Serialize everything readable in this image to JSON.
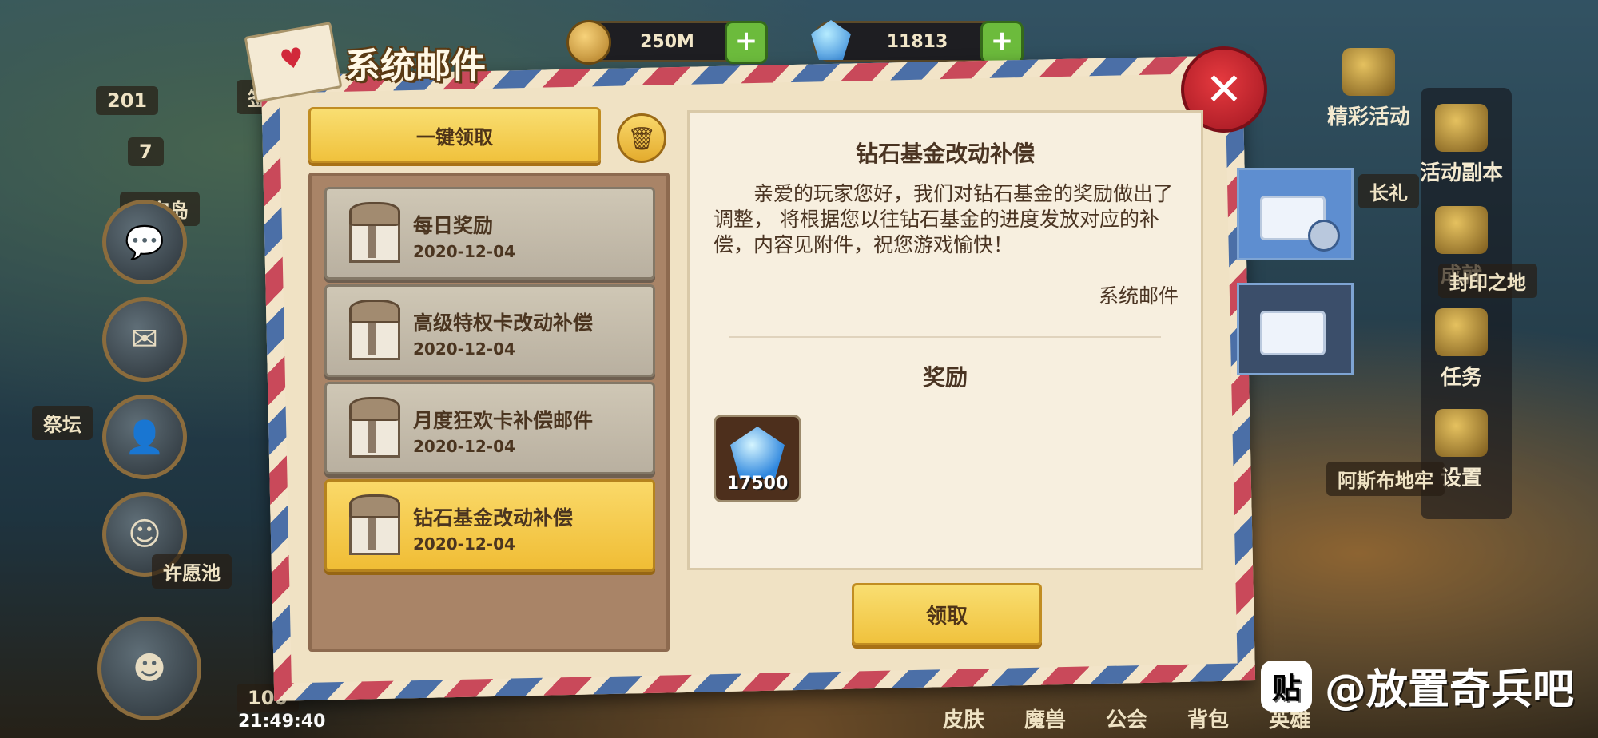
{
  "resources": {
    "gold": "250M",
    "gems": "11813",
    "plus": "+"
  },
  "left_labels": {
    "level": "201",
    "rank": "7",
    "island": "星空岛",
    "altar": "祭坛",
    "wish_pool": "许愿池",
    "time": "21:49:40",
    "partial_100": "100",
    "partial_sign": "签"
  },
  "right_menu": {
    "items": [
      "精彩活动",
      "活动副本",
      "成就",
      "任务",
      "设置"
    ],
    "partial_labels": [
      "长礼",
      "封印之地",
      "阿斯布地牢"
    ]
  },
  "bottom_tabs": [
    "皮肤",
    "魔兽",
    "公会",
    "背包",
    "英雄"
  ],
  "dialog": {
    "title": "系统邮件",
    "claim_all_label": "一键领取",
    "close_symbol": "✕",
    "trash_symbol": "🗑",
    "mails": [
      {
        "name": "每日奖励",
        "date": "2020-12-04",
        "selected": false
      },
      {
        "name": "高级特权卡改动补偿",
        "date": "2020-12-04",
        "selected": false
      },
      {
        "name": "月度狂欢卡补偿邮件",
        "date": "2020-12-04",
        "selected": false
      },
      {
        "name": "钻石基金改动补偿",
        "date": "2020-12-04",
        "selected": true
      }
    ],
    "content": {
      "title": "钻石基金改动补偿",
      "body": "亲爱的玩家您好，我们对钻石基金的奖励做出了调整， 将根据您以往钻石基金的进度发放对应的补偿，内容见附件，祝您游戏愉快！",
      "signature": "系统邮件",
      "reward_header": "奖励",
      "reward": {
        "icon": "diamond-icon",
        "quantity": "17500"
      }
    },
    "claim_label": "领取"
  },
  "watermark": {
    "badge": "贴",
    "text": "@放置奇兵吧"
  },
  "colors": {
    "accent_yellow": "#f0c23d",
    "selected_item": "#fad969",
    "close_red": "#c41f2a",
    "mail_tab_blue": "#5e8ed0"
  }
}
